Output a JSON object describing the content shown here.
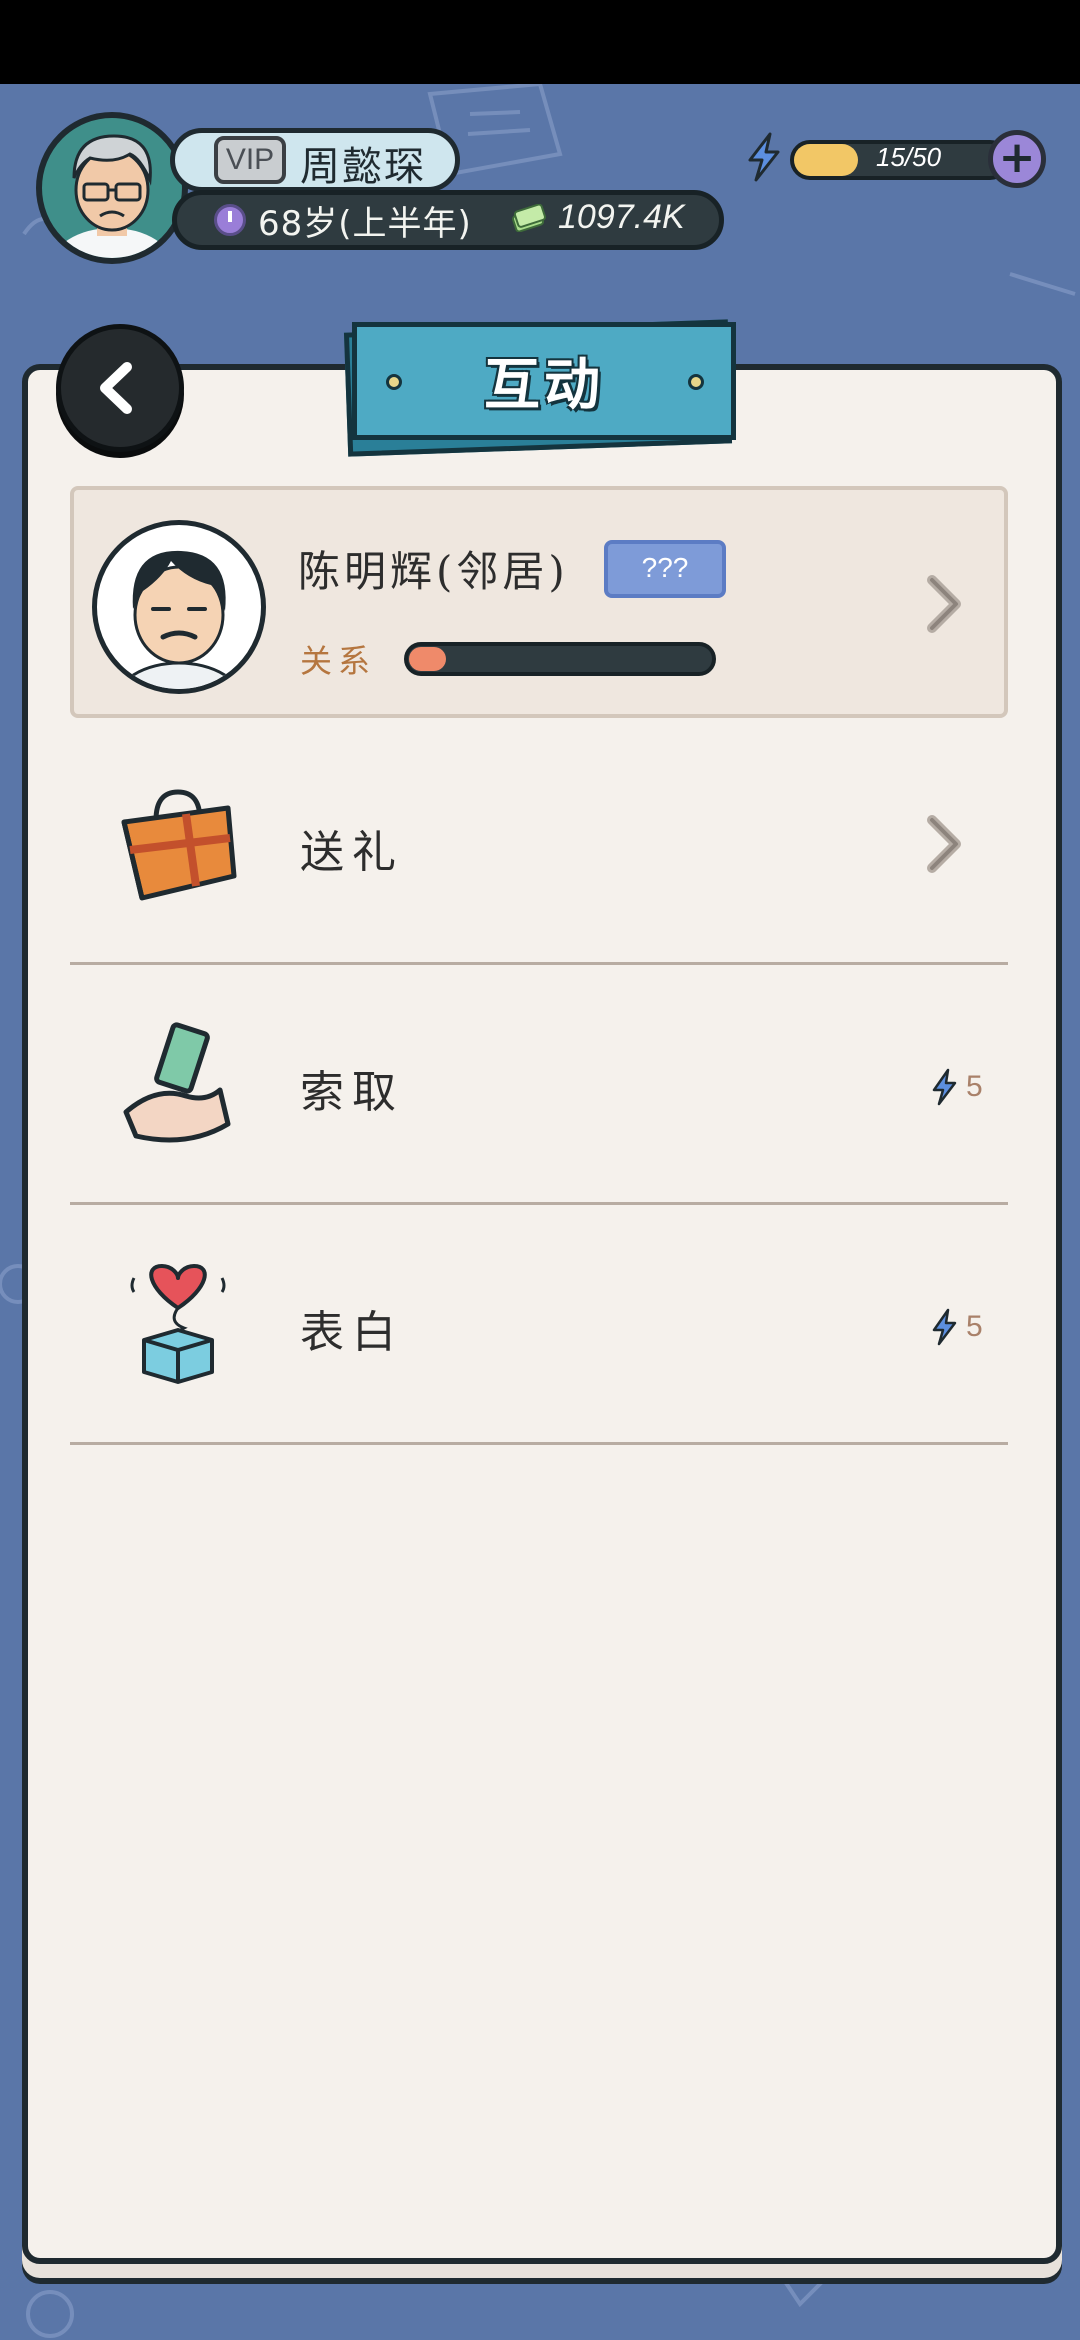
{
  "hud": {
    "vip_label": "VIP",
    "player_name": "周懿琛",
    "age": "68岁(上半年)",
    "money": "1097.4K",
    "energy": "15/50",
    "energy_fraction": 0.3,
    "add_label": "+"
  },
  "panel": {
    "title": "互动"
  },
  "npc": {
    "name": "陈明辉(邻居)",
    "tag": "???",
    "relation_label": "关系",
    "relation_fraction": 0.12
  },
  "actions": [
    {
      "label": "送礼",
      "icon": "gift-bag-icon",
      "cost": ""
    },
    {
      "label": "索取",
      "icon": "hand-money-icon",
      "cost": "5"
    },
    {
      "label": "表白",
      "icon": "heart-box-icon",
      "cost": "5"
    }
  ],
  "colors": {
    "background": "#5a76a8",
    "paper": "#f5f1ec",
    "title_plate": "#4eaac4",
    "energy": "#f2c766",
    "relation": "#ef8a6a",
    "tag": "#7e9bd8"
  }
}
